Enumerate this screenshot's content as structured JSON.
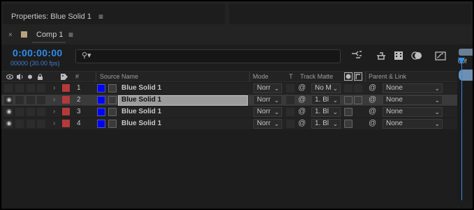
{
  "top_panel": {
    "title": "Properties: Blue Solid 1",
    "menu_icon": "hamburger-icon"
  },
  "comp_tab": {
    "close": "×",
    "name": "Comp 1",
    "swatch_color": "#bba27e"
  },
  "time": {
    "timecode": "0:00:00:00",
    "fps": "00000 (30.00 fps)",
    "color": "#2d8ceb"
  },
  "search": {
    "placeholder": "",
    "icon": "search-icon"
  },
  "toolbar_icons": [
    "composition-mini-flowchart-icon",
    "draft-3d-icon",
    "frame-blending-icon",
    "motion-blur-icon",
    "graph-editor-icon"
  ],
  "ruler": {
    "label": "00f"
  },
  "columns": {
    "source_name": "Source Name",
    "number": "#",
    "mode": "Mode",
    "t": "T",
    "track_matte": "Track Matte",
    "parent_link": "Parent & Link"
  },
  "layers": [
    {
      "number": "1",
      "name": "Blue Solid 1",
      "mode": "Norr",
      "track_matte": "No M",
      "parent": "None",
      "selected": false,
      "visible": false
    },
    {
      "number": "2",
      "name": "Blue Solid 1",
      "mode": "Norr",
      "track_matte": "1. Bl",
      "parent": "None",
      "selected": true,
      "visible": true
    },
    {
      "number": "3",
      "name": "Blue Solid 1",
      "mode": "Norr",
      "track_matte": "1. Bl",
      "parent": "None",
      "selected": false,
      "visible": true
    },
    {
      "number": "4",
      "name": "Blue Solid 1",
      "mode": "Norr",
      "track_matte": "1. Bl",
      "parent": "None",
      "selected": false,
      "visible": true
    }
  ],
  "colors": {
    "label_red": "#b33a3a",
    "layer_blue": "#0000ff",
    "accent_blue": "#2f8ee8"
  }
}
